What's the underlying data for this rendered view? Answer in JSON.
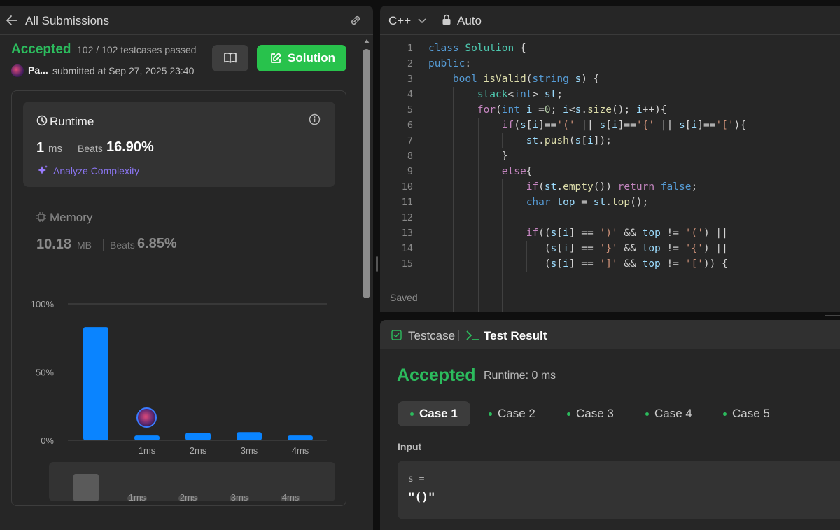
{
  "left": {
    "header_title": "All Submissions",
    "status": "Accepted",
    "testcases": "102 / 102 testcases passed",
    "user": "Pa...",
    "submitted": "submitted at Sep 27, 2025 23:40",
    "solution_label": "Solution",
    "runtime": {
      "label": "Runtime",
      "value": "1",
      "unit": "ms",
      "beats_label": "Beats",
      "beats_value": "16.90%",
      "analyze": "Analyze Complexity"
    },
    "memory": {
      "label": "Memory",
      "value": "10.18",
      "unit": "MB",
      "beats_label": "Beats",
      "beats_value": "6.85%"
    }
  },
  "chart_data": {
    "type": "bar",
    "y_ticks": [
      "100%",
      "50%",
      "0%"
    ],
    "ylim": [
      0,
      100
    ],
    "categories": [
      "",
      "1ms",
      "2ms",
      "3ms",
      "4ms"
    ],
    "values": [
      83,
      3.5,
      5.5,
      6,
      3.5
    ],
    "bar_color": "#0a84ff",
    "highlight_category": "1ms",
    "mini_values": [
      52,
      0,
      0,
      0,
      0
    ]
  },
  "editor": {
    "language": "C++",
    "mode": "Auto",
    "saved": "Saved",
    "lines": [
      "1",
      "2",
      "3",
      "4",
      "5",
      "6",
      "7",
      "8",
      "9",
      "10",
      "11",
      "12",
      "13",
      "14",
      "15"
    ]
  },
  "result": {
    "tab_testcase": "Testcase",
    "tab_result": "Test Result",
    "status": "Accepted",
    "runtime": "Runtime: 0 ms",
    "cases": [
      "Case 1",
      "Case 2",
      "Case 3",
      "Case 4",
      "Case 5"
    ],
    "input_label": "Input",
    "var_label": "s =",
    "var_value": "\"()\""
  },
  "colors": {
    "accent_green": "#2cbb5d",
    "bar_blue": "#0a84ff",
    "purple": "#8a75f0"
  }
}
